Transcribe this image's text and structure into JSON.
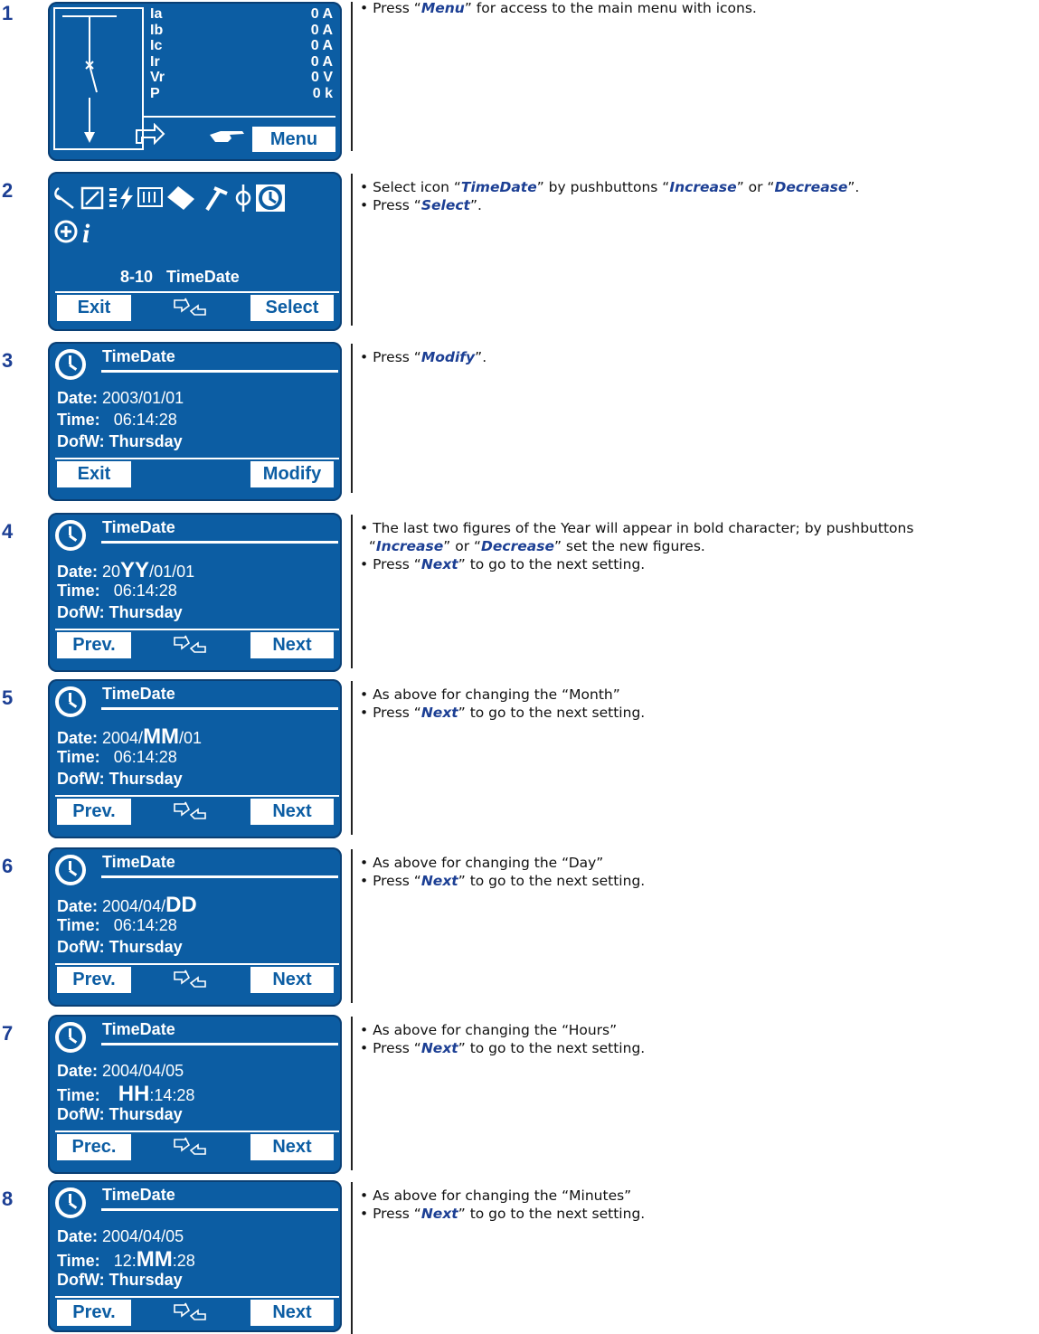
{
  "steps": [
    {
      "num": "1"
    },
    {
      "num": "2"
    },
    {
      "num": "3"
    },
    {
      "num": "4"
    },
    {
      "num": "5"
    },
    {
      "num": "6"
    },
    {
      "num": "7"
    },
    {
      "num": "8"
    }
  ],
  "screen1": {
    "labels": [
      "Ia",
      "Ib",
      "Ic",
      "Ir",
      "Vr",
      "P"
    ],
    "values": [
      "0 A",
      "0 A",
      "0 A",
      "0 A",
      "0 V",
      "0 k"
    ],
    "menu_button": "Menu"
  },
  "screen2": {
    "caption_num": "8-10",
    "caption_name": "TimeDate",
    "exit": "Exit",
    "select": "Select"
  },
  "td_title": "TimeDate",
  "screen3": {
    "date_label": "Date:",
    "date": "2003/01/01",
    "time_label": "Time:",
    "time": "06:14:28",
    "dofw_label": "DofW:",
    "dofw": "Thursday",
    "left": "Exit",
    "right": "Modify"
  },
  "screen4": {
    "date_pre": "20",
    "date_big": "YY",
    "date_post": "/01/01",
    "time": "06:14:28",
    "dofw": "Thursday",
    "left": "Prev.",
    "right": "Next"
  },
  "screen5": {
    "date_pre": "2004/",
    "date_big": "MM",
    "date_post": "/01",
    "time": "06:14:28",
    "dofw": "Thursday",
    "left": "Prev.",
    "right": "Next"
  },
  "screen6": {
    "date_pre": "2004/04/",
    "date_big": "DD",
    "date_post": "",
    "time": "06:14:28",
    "dofw": "Thursday",
    "left": "Prev.",
    "right": "Next"
  },
  "screen7": {
    "date": "2004/04/05",
    "time_pre": "",
    "time_big": "HH",
    "time_post": ":14:28",
    "dofw": "Thursday",
    "left": "Prec.",
    "right": "Next"
  },
  "screen8": {
    "date": "2004/04/05",
    "time_pre": "12:",
    "time_big": "MM",
    "time_post": ":28",
    "dofw": "Thursday",
    "left": "Prev.",
    "right": "Next"
  },
  "desc": {
    "s1": {
      "a": "• Press “",
      "k": "Menu",
      "b": "” for access to the main menu with icons."
    },
    "s2": {
      "l1a": "• Select icon “",
      "l1k1": "TimeDate",
      "l1b": "” by pushbuttons “",
      "l1k2": "Increase",
      "l1c": "” or “",
      "l1k3": "Decrease",
      "l1d": "”.",
      "l2a": "• Press “",
      "l2k": "Select",
      "l2b": "”."
    },
    "s3": {
      "a": "• Press “",
      "k": "Modify",
      "b": "”."
    },
    "s4": {
      "l1": "• The last two figures of the Year will appear in bold character; by pushbuttons",
      "l2a": "“",
      "l2k1": "Increase",
      "l2b": "” or “",
      "l2k2": "Decrease",
      "l2c": "” set the new figures.",
      "l3a": "• Press “",
      "l3k": "Next",
      "l3b": "” to go to the next setting."
    },
    "s5": {
      "l1": "• As above for changing the “Month”",
      "l2a": "• Press “",
      "l2k": "Next",
      "l2b": "” to go to the next setting."
    },
    "s6": {
      "l1": "• As above for changing the “Day”",
      "l2a": "• Press “",
      "l2k": "Next",
      "l2b": "” to go to the next setting."
    },
    "s7": {
      "l1": "• As above for changing the “Hours”",
      "l2a": "• Press “",
      "l2k": "Next",
      "l2b": "” to go to the next setting."
    },
    "s8": {
      "l1": "• As above for changing the “Minutes”",
      "l2a": "• Press “",
      "l2k": "Next",
      "l2b": "” to go to the next setting."
    }
  }
}
